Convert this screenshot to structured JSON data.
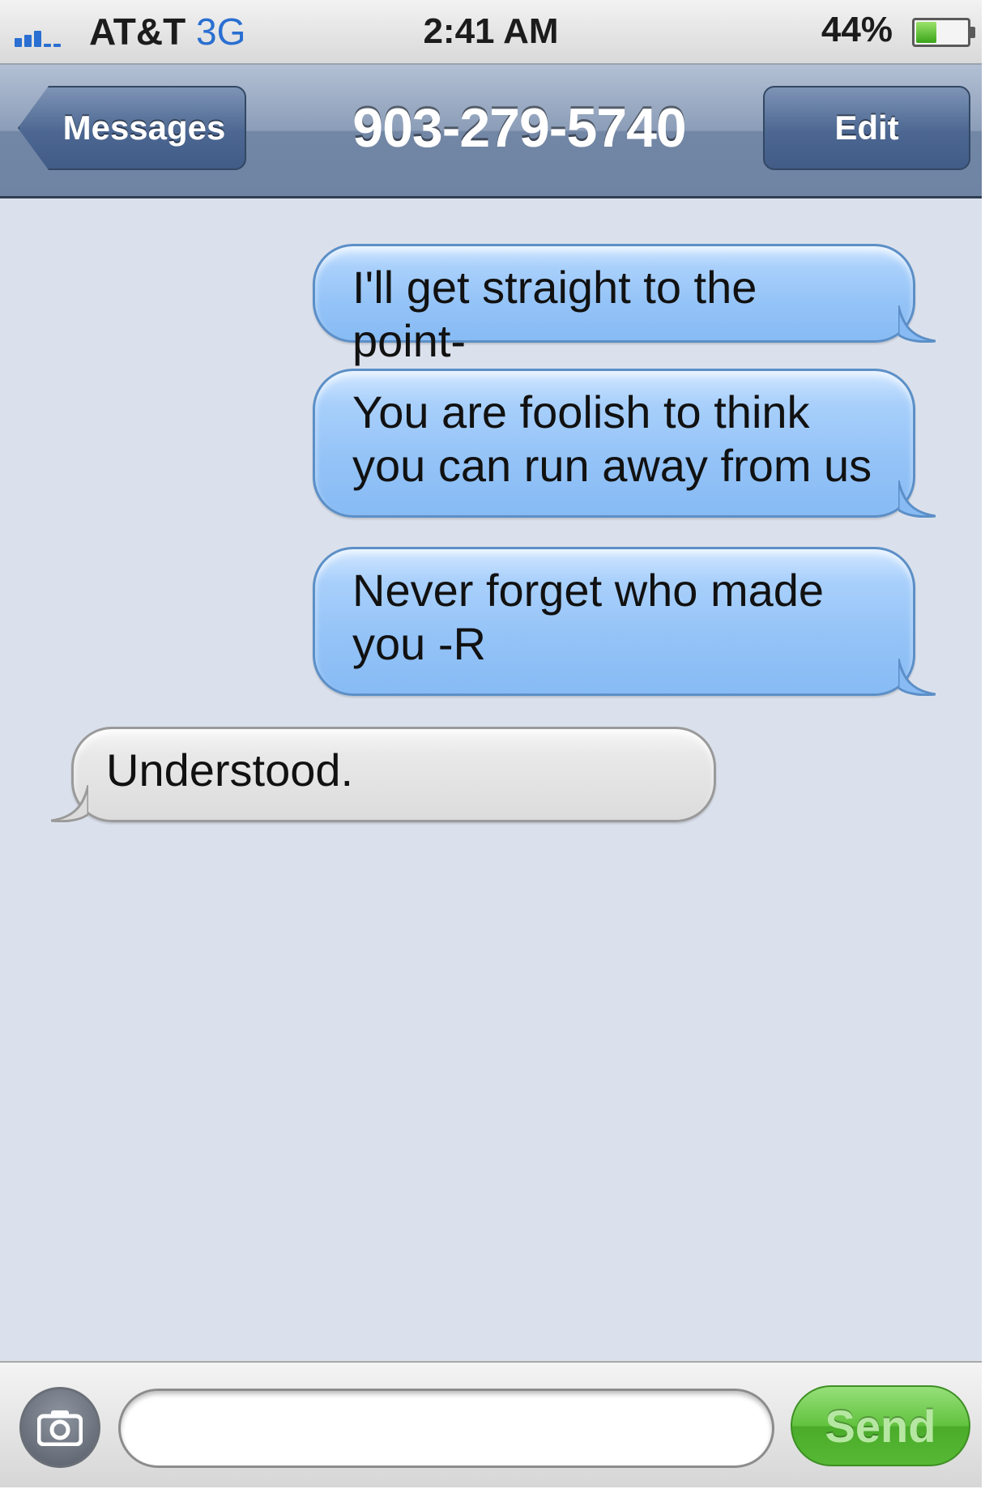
{
  "status_bar": {
    "carrier": "AT&T",
    "network": "3G",
    "time": "2:41 AM",
    "battery_percent": "44%",
    "battery_level": 0.44,
    "signal_bars": 3
  },
  "nav": {
    "back_label": "Messages",
    "title": "903-279-5740",
    "edit_label": "Edit"
  },
  "messages": [
    {
      "direction": "sent",
      "text": "I'll get straight to the point-"
    },
    {
      "direction": "sent",
      "text": "You are foolish to think you can run away from us"
    },
    {
      "direction": "sent",
      "text": "Never forget who made you -R"
    },
    {
      "direction": "received",
      "text": "Understood."
    }
  ],
  "composer": {
    "input_value": "",
    "send_label": "Send"
  },
  "colors": {
    "sent_bubble": "#94c3f7",
    "received_bubble": "#e3e3e3",
    "nav_bar": "#7f93b2",
    "send_button": "#5fbe3c",
    "background": "#dbe1ec"
  },
  "icons": {
    "signal": "signal-bars-icon",
    "battery": "battery-icon",
    "camera": "camera-icon"
  }
}
